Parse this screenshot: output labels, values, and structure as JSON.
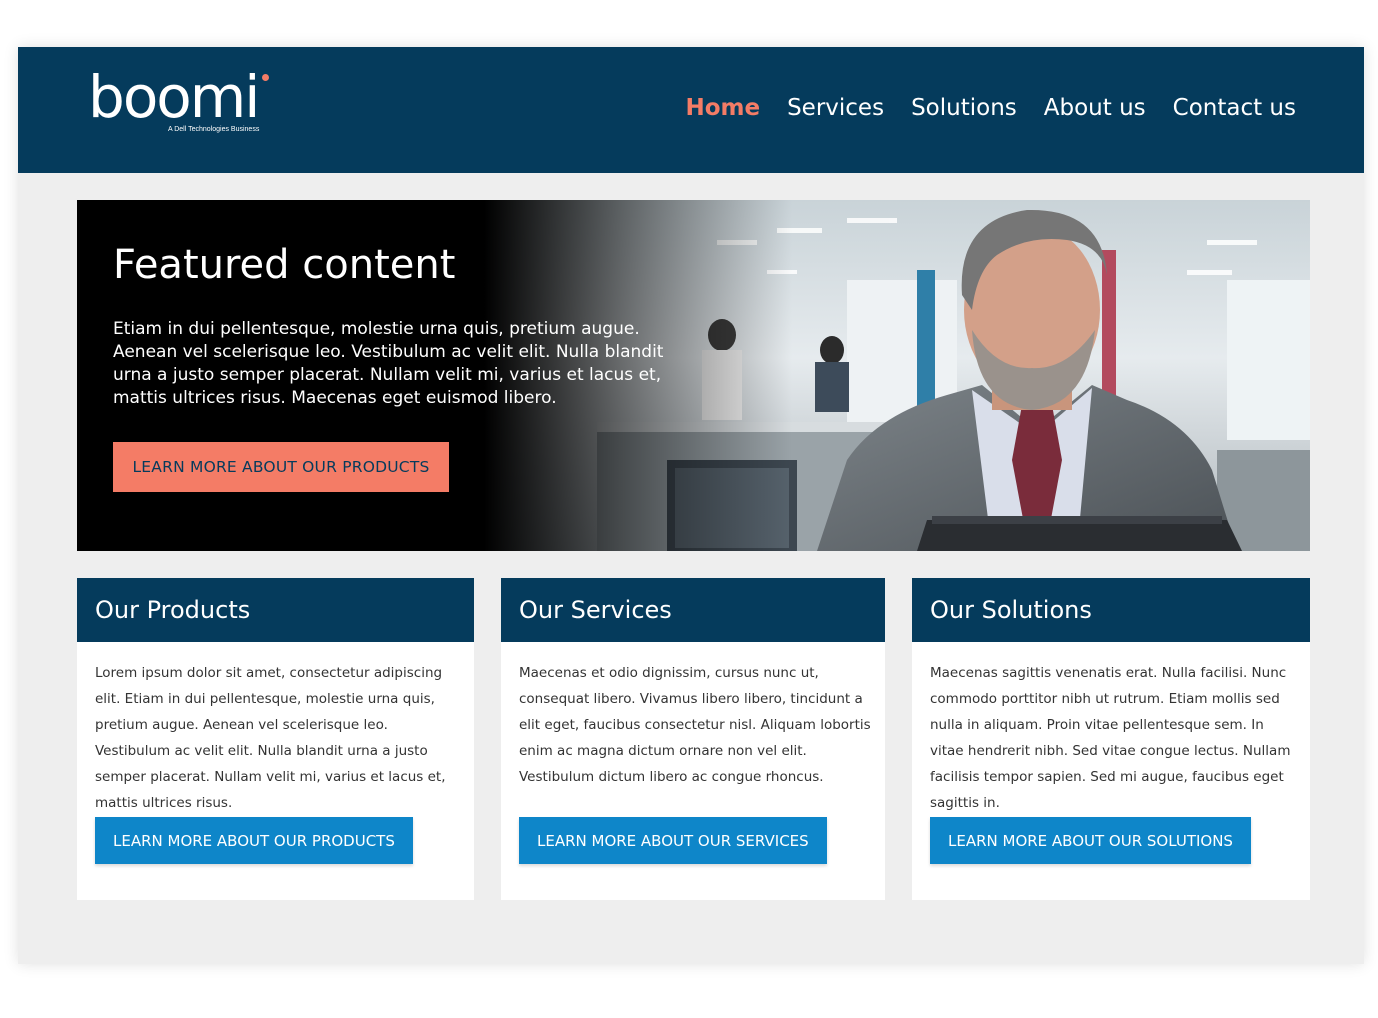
{
  "logo": {
    "wordmark": "boomi",
    "tagline": "A Dell Technologies Business"
  },
  "nav": {
    "items": [
      {
        "label": "Home",
        "active": true
      },
      {
        "label": "Services",
        "active": false
      },
      {
        "label": "Solutions",
        "active": false
      },
      {
        "label": "About us",
        "active": false
      },
      {
        "label": "Contact us",
        "active": false
      }
    ]
  },
  "hero": {
    "title": "Featured content",
    "text": "Etiam in dui pellentesque, molestie urna quis, pretium augue. Aenean vel scelerisque leo. Vestibulum ac velit elit. Nulla blandit urna a justo semper placerat. Nullam velit mi, varius et lacus et, mattis ultrices risus. Maecenas eget euismod libero.",
    "button_label": "LEARN MORE ABOUT OUR PRODUCTS"
  },
  "cards": [
    {
      "title": "Our Products",
      "text": "Lorem ipsum dolor sit amet, consectetur adipiscing elit. Etiam in dui pellentesque, molestie urna quis, pretium augue. Aenean vel scelerisque leo. Vestibulum ac velit elit. Nulla blandit urna a justo semper placerat. Nullam velit mi, varius et lacus et, mattis ultrices risus.",
      "button_label": "LEARN MORE ABOUT OUR PRODUCTS"
    },
    {
      "title": "Our Services",
      "text": "Maecenas et odio dignissim, cursus nunc ut, consequat libero. Vivamus libero libero, tincidunt a elit eget, faucibus consectetur nisl. Aliquam lobortis enim ac magna dictum ornare non vel elit. Vestibulum dictum libero ac congue rhoncus.",
      "button_label": "LEARN MORE ABOUT OUR SERVICES"
    },
    {
      "title": "Our Solutions",
      "text": "Maecenas sagittis venenatis erat. Nulla facilisi. Nunc commodo porttitor nibh ut rutrum. Etiam mollis sed nulla in aliquam. Proin vitae pellentesque sem. In vitae hendrerit nibh. Sed vitae congue lectus. Nullam facilisis tempor sapien. Sed mi augue, faucibus eget sagittis in.",
      "button_label": "LEARN MORE ABOUT OUR SOLUTIONS"
    }
  ],
  "colors": {
    "navy": "#053b5c",
    "coral": "#f47c66",
    "blue_button": "#0e86c9",
    "page_bg": "#eeeeee"
  },
  "icons": {
    "hero_image": "office-man-laptop-photo"
  }
}
